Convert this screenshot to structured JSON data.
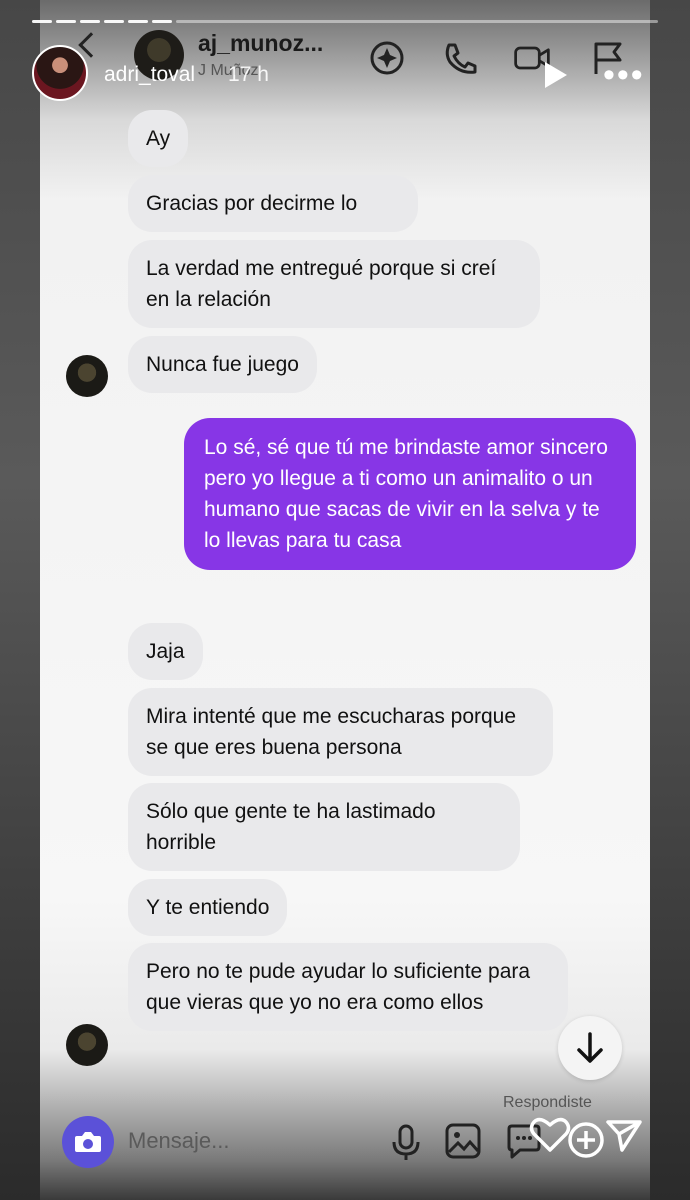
{
  "story": {
    "username": "adri_toval",
    "time": "17 h"
  },
  "dm": {
    "name": "aj_munoz...",
    "subtitle": "J Muñoz"
  },
  "messages": [
    {
      "text": "Ay",
      "sender": "them"
    },
    {
      "text": "Gracias por decirme lo",
      "sender": "them"
    },
    {
      "text": "La verdad me entregué porque si creí en la relación",
      "sender": "them"
    },
    {
      "text": "Nunca fue juego",
      "sender": "them"
    },
    {
      "text": "Lo sé, sé que tú me brindaste amor sincero pero yo llegue a ti como un animalito o un humano que sacas de vivir en la selva y te lo llevas para tu casa",
      "sender": "me"
    },
    {
      "text": "Jaja",
      "sender": "them"
    },
    {
      "text": "Mira intenté que me escucharas porque se que eres buena persona",
      "sender": "them"
    },
    {
      "text": "Sólo que gente te ha lastimado horrible",
      "sender": "them"
    },
    {
      "text": "Y te entiendo",
      "sender": "them"
    },
    {
      "text": "Pero no te pude ayudar lo suficiente para que vieras que yo no era como ellos",
      "sender": "them"
    }
  ],
  "seen_label": "Respondiste",
  "composer": {
    "placeholder": "Mensaje..."
  },
  "icons": {
    "back": "chevron-left-icon",
    "effects": "sparkle-icon",
    "call": "phone-icon",
    "video": "video-camera-icon",
    "flag": "flag-icon",
    "camera": "camera-icon",
    "mic": "microphone-icon",
    "gallery": "image-icon",
    "sticker": "chat-sticker-icon",
    "like": "heart-icon",
    "add": "plus-circle-icon",
    "send": "send-icon",
    "scroll": "arrow-down-icon"
  },
  "colors": {
    "sent_bubble": "#8736e6",
    "received_bubble": "#e9e9eb",
    "camera_button": "#5b51d8"
  }
}
